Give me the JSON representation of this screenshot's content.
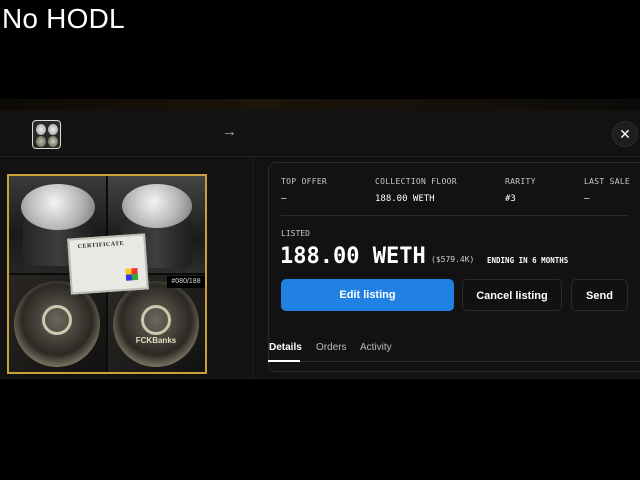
{
  "caption": "No HODL",
  "toolbar": {
    "arrow_icon": "→",
    "close_icon": "✕"
  },
  "image": {
    "certificate_title": "CERTIFICATE",
    "edition": "#080/188",
    "coin_text": "FCKBanks"
  },
  "stats": [
    {
      "label": "TOP OFFER",
      "value": "–"
    },
    {
      "label": "COLLECTION FLOOR",
      "value": "188.00 WETH"
    },
    {
      "label": "RARITY",
      "value": "#3"
    },
    {
      "label": "LAST SALE",
      "value": "–"
    }
  ],
  "listing": {
    "label": "LISTED",
    "price": "188.00 WETH",
    "usd": "($579.4K)",
    "ending": "ENDING IN 6 MONTHS"
  },
  "buttons": {
    "edit": "Edit listing",
    "cancel": "Cancel listing",
    "send": "Send"
  },
  "tabs": [
    {
      "label": "Details",
      "active": true
    },
    {
      "label": "Orders",
      "active": false
    },
    {
      "label": "Activity",
      "active": false
    }
  ],
  "colors": {
    "accent": "#2081e2",
    "frame": "#c8a13a",
    "panel": "#121212"
  }
}
